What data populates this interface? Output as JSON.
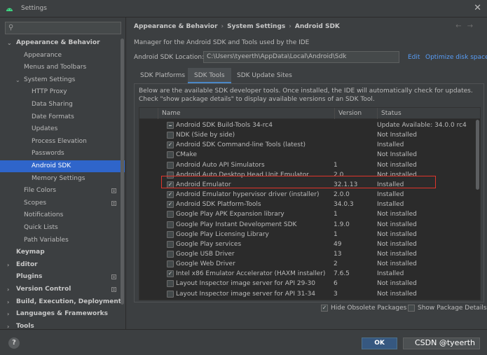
{
  "window": {
    "title": "Settings",
    "close_symbol": "✕"
  },
  "search": {
    "placeholder": "",
    "icon": "search-icon"
  },
  "sidebar": {
    "items": [
      {
        "label": "Appearance & Behavior",
        "level": 0,
        "bold": true,
        "arrow": "open"
      },
      {
        "label": "Appearance",
        "level": 1
      },
      {
        "label": "Menus and Toolbars",
        "level": 1
      },
      {
        "label": "System Settings",
        "level": 1,
        "arrow": "open"
      },
      {
        "label": "HTTP Proxy",
        "level": 2
      },
      {
        "label": "Data Sharing",
        "level": 2
      },
      {
        "label": "Date Formats",
        "level": 2
      },
      {
        "label": "Updates",
        "level": 2
      },
      {
        "label": "Process Elevation",
        "level": 2
      },
      {
        "label": "Passwords",
        "level": 2
      },
      {
        "label": "Android SDK",
        "level": 2,
        "selected": true
      },
      {
        "label": "Memory Settings",
        "level": 2
      },
      {
        "label": "File Colors",
        "level": 1,
        "project": true
      },
      {
        "label": "Scopes",
        "level": 1,
        "project": true
      },
      {
        "label": "Notifications",
        "level": 1
      },
      {
        "label": "Quick Lists",
        "level": 1
      },
      {
        "label": "Path Variables",
        "level": 1
      },
      {
        "label": "Keymap",
        "level": 0,
        "bold": true
      },
      {
        "label": "Editor",
        "level": 0,
        "bold": true,
        "arrow": "closed"
      },
      {
        "label": "Plugins",
        "level": 0,
        "bold": true,
        "project": true
      },
      {
        "label": "Version Control",
        "level": 0,
        "bold": true,
        "arrow": "closed",
        "project": true
      },
      {
        "label": "Build, Execution, Deployment",
        "level": 0,
        "bold": true,
        "arrow": "closed"
      },
      {
        "label": "Languages & Frameworks",
        "level": 0,
        "bold": true,
        "arrow": "closed"
      },
      {
        "label": "Tools",
        "level": 0,
        "bold": true,
        "arrow": "closed"
      }
    ]
  },
  "breadcrumb": [
    "Appearance & Behavior",
    "System Settings",
    "Android SDK"
  ],
  "nav": {
    "back": "←",
    "forward": "→"
  },
  "main": {
    "description": "Manager for the Android SDK and Tools used by the IDE",
    "location_label": "Android SDK Location:",
    "location_value": "C:\\Users\\tyeerth\\AppData\\Local\\Android\\Sdk",
    "edit_link": "Edit",
    "optimize_link": "Optimize disk space"
  },
  "tabs": [
    "SDK Platforms",
    "SDK Tools",
    "SDK Update Sites"
  ],
  "active_tab": 1,
  "panel": {
    "description": "Below are the available SDK developer tools. Once installed, the IDE will automatically check for updates. Check \"show package details\" to display available versions of an SDK Tool.",
    "columns": [
      "",
      "Name",
      "Version",
      "Status"
    ],
    "rows": [
      {
        "check": "mixed",
        "name": "Android SDK Build-Tools 34-rc4",
        "version": "",
        "status": "Update Available: 34.0.0 rc4"
      },
      {
        "check": "off",
        "name": "NDK (Side by side)",
        "version": "",
        "status": "Not Installed"
      },
      {
        "check": "on",
        "name": "Android SDK Command-line Tools (latest)",
        "version": "",
        "status": "Installed"
      },
      {
        "check": "off",
        "name": "CMake",
        "version": "",
        "status": "Not Installed"
      },
      {
        "check": "off",
        "name": "Android Auto API Simulators",
        "version": "1",
        "status": "Not installed"
      },
      {
        "check": "off",
        "name": "Android Auto Desktop Head Unit Emulator",
        "version": "2.0",
        "status": "Not installed"
      },
      {
        "check": "on",
        "name": "Android Emulator",
        "version": "32.1.13",
        "status": "Installed"
      },
      {
        "check": "on",
        "name": "Android Emulator hypervisor driver (installer)",
        "version": "2.0.0",
        "status": "Installed"
      },
      {
        "check": "on",
        "name": "Android SDK Platform-Tools",
        "version": "34.0.3",
        "status": "Installed"
      },
      {
        "check": "off",
        "name": "Google Play APK Expansion library",
        "version": "1",
        "status": "Not installed"
      },
      {
        "check": "off",
        "name": "Google Play Instant Development SDK",
        "version": "1.9.0",
        "status": "Not installed"
      },
      {
        "check": "off",
        "name": "Google Play Licensing Library",
        "version": "1",
        "status": "Not installed"
      },
      {
        "check": "off",
        "name": "Google Play services",
        "version": "49",
        "status": "Not installed"
      },
      {
        "check": "off",
        "name": "Google USB Driver",
        "version": "13",
        "status": "Not installed"
      },
      {
        "check": "off",
        "name": "Google Web Driver",
        "version": "2",
        "status": "Not installed"
      },
      {
        "check": "on",
        "name": "Intel x86 Emulator Accelerator (HAXM installer)",
        "version": "7.6.5",
        "status": "Installed"
      },
      {
        "check": "off",
        "name": "Layout Inspector image server for API 29-30",
        "version": "6",
        "status": "Not installed"
      },
      {
        "check": "off",
        "name": "Layout Inspector image server for API 31-34",
        "version": "3",
        "status": "Not installed"
      }
    ]
  },
  "options": {
    "hide_obsolete": {
      "label": "Hide Obsolete Packages",
      "checked": true
    },
    "show_details": {
      "label": "Show Package Details",
      "checked": false
    }
  },
  "footer": {
    "help": "?",
    "ok_label": "OK",
    "watermark": "CSDN @tyeerth"
  },
  "colors": {
    "selection": "#2f65ca",
    "link": "#589df6",
    "highlight": "#e0352b",
    "ok_button": "#365880"
  }
}
